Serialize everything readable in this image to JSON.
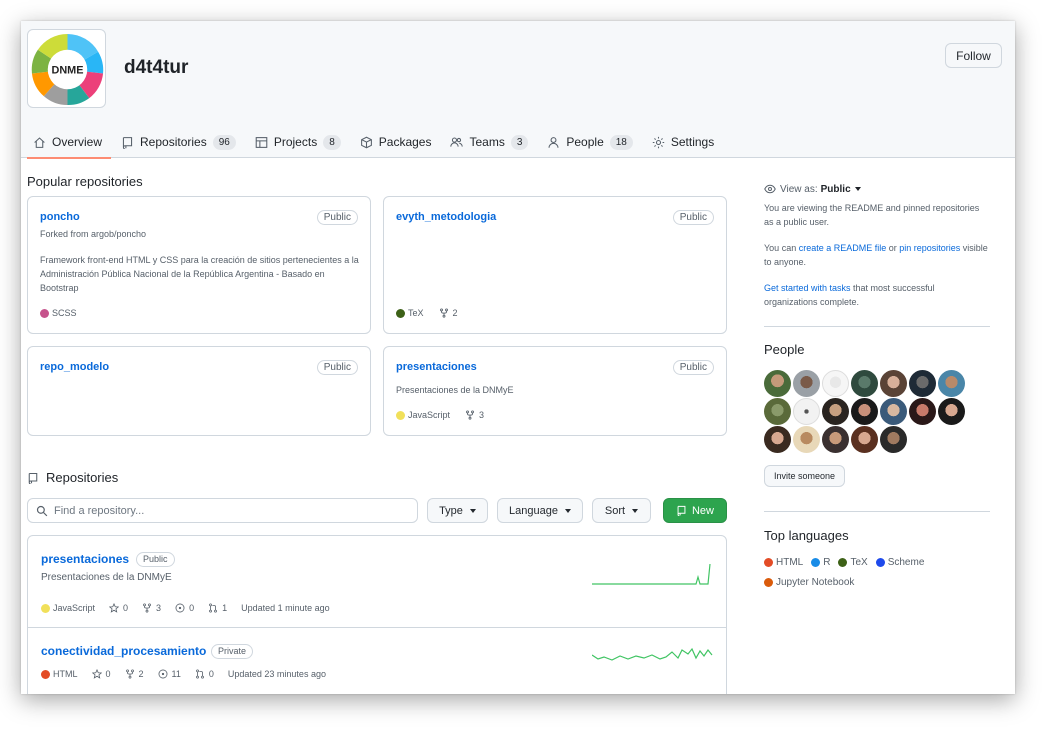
{
  "header": {
    "org_name": "d4t4tur",
    "logo_text": "DNME",
    "follow_label": "Follow"
  },
  "tabs": [
    {
      "label": "Overview",
      "icon": "home-icon",
      "active": true
    },
    {
      "label": "Repositories",
      "icon": "repo-icon",
      "count": "96"
    },
    {
      "label": "Projects",
      "icon": "table-icon",
      "count": "8"
    },
    {
      "label": "Packages",
      "icon": "package-icon"
    },
    {
      "label": "Teams",
      "icon": "people-icon",
      "count": "3"
    },
    {
      "label": "People",
      "icon": "person-icon",
      "count": "18"
    },
    {
      "label": "Settings",
      "icon": "gear-icon"
    }
  ],
  "popular": {
    "title": "Popular repositories",
    "cards": [
      {
        "name": "poncho",
        "visibility": "Public",
        "forked_from": "Forked from argob/poncho",
        "description": "Framework front-end HTML y CSS para la creación de sitios pertenecientes a la Administración Pública Nacional de la República Argentina - Basado en Bootstrap",
        "language": "SCSS",
        "language_color": "#c6538c"
      },
      {
        "name": "evyth_metodologia",
        "visibility": "Public",
        "language": "TeX",
        "language_color": "#3d6117",
        "forks": "2"
      },
      {
        "name": "repo_modelo",
        "visibility": "Public"
      },
      {
        "name": "presentaciones",
        "visibility": "Public",
        "description": "Presentaciones de la DNMyE",
        "language": "JavaScript",
        "language_color": "#f1e05a",
        "forks": "3"
      }
    ]
  },
  "repositories": {
    "title": "Repositories",
    "search_placeholder": "Find a repository...",
    "type_label": "Type",
    "language_label": "Language",
    "sort_label": "Sort",
    "new_label": "New",
    "items": [
      {
        "name": "presentaciones",
        "visibility": "Public",
        "description": "Presentaciones de la DNMyE",
        "language": "JavaScript",
        "language_color": "#f1e05a",
        "stars": "0",
        "forks": "3",
        "issues": "0",
        "pulls": "1",
        "updated": "Updated 1 minute ago"
      },
      {
        "name": "conectividad_procesamiento",
        "visibility": "Private",
        "language": "HTML",
        "language_color": "#e34c26",
        "stars": "0",
        "forks": "2",
        "issues": "11",
        "pulls": "0",
        "updated": "Updated 23 minutes ago"
      }
    ]
  },
  "sidebar": {
    "view_as_label": "View as:",
    "view_as_value": "Public",
    "view_desc": "You are viewing the README and pinned repositories as a public user.",
    "can_prefix": "You can ",
    "create_readme": "create a README file",
    "or_text": " or ",
    "pin_repos": "pin repositories",
    "visible_text": " visible to anyone.",
    "get_started": "Get started with tasks",
    "get_started_rest": " that most successful organizations complete.",
    "people_title": "People",
    "invite_label": "Invite someone",
    "languages_title": "Top languages",
    "languages": [
      {
        "name": "HTML",
        "color": "#e34c26"
      },
      {
        "name": "R",
        "color": "#198ce7"
      },
      {
        "name": "TeX",
        "color": "#3d6117"
      },
      {
        "name": "Scheme",
        "color": "#1e4aec"
      },
      {
        "name": "Jupyter Notebook",
        "color": "#da5b0b"
      }
    ]
  },
  "colors": {
    "link": "#0969da",
    "accent_underline": "#fd8c73",
    "new_button": "#2da44e",
    "spark_line": "#40c463"
  }
}
